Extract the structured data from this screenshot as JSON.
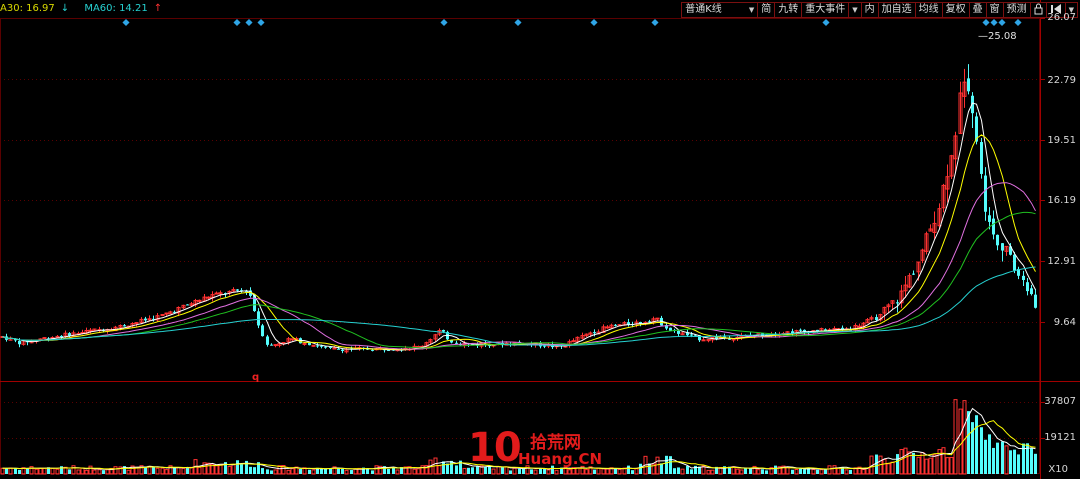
{
  "ma_legend": [
    {
      "label": "A30: 16.97",
      "arrow": "↓",
      "color": "#d9d900"
    },
    {
      "label": "MA60: 14.21",
      "arrow": "↑",
      "color": "#26d0d0"
    }
  ],
  "toolbar": {
    "kline_select": "普通K线",
    "simple": "简",
    "nine": "九转",
    "events": "重大事件",
    "inner": "内",
    "add_watch": "加自选",
    "ma_lines": "均线",
    "adjust": "复权",
    "overlay": "叠",
    "window": "窗",
    "forecast": "预测"
  },
  "price_axis": [
    "26.07",
    "22.79",
    "19.51",
    "16.19",
    "12.91",
    "9.64"
  ],
  "volume_axis": [
    "37807",
    "19121"
  ],
  "volume_multiplier": "X10",
  "peak_label": "25.08",
  "low_marker": "q",
  "watermark": {
    "digits": "10",
    "cn": "拾荒网",
    "domain": "Huang.CN"
  },
  "colors": {
    "up": "#ff3232",
    "down": "#54fcfc",
    "grid": "#5a0000",
    "event": "#2fa5e6"
  },
  "chart_data": {
    "type": "candlestick",
    "title": "",
    "price_range": [
      8.5,
      26.07
    ],
    "volume_range": [
      0,
      40000
    ],
    "peak_high": 25.08,
    "series": [
      {
        "name": "A30",
        "last": 16.97
      },
      {
        "name": "MA60",
        "last": 14.21
      }
    ]
  }
}
